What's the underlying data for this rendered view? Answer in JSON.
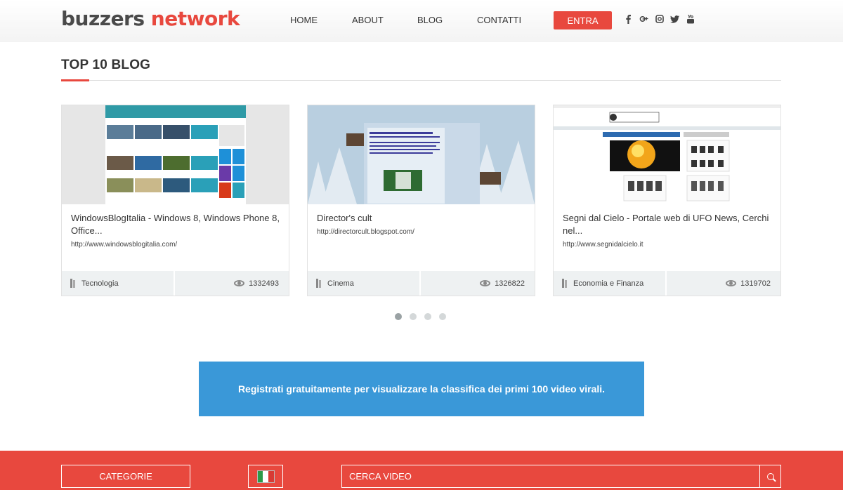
{
  "header": {
    "logo_part1": "buzzers",
    "logo_part2": "network",
    "nav": [
      "HOME",
      "ABOUT",
      "BLOG",
      "CONTATTI"
    ],
    "entra_label": "ENTRA",
    "social_icons": [
      "facebook-icon",
      "google-plus-icon",
      "instagram-icon",
      "twitter-icon",
      "youtube-icon"
    ]
  },
  "section": {
    "title": "TOP 10 BLOG"
  },
  "cards": [
    {
      "title": "WindowsBlogItalia - Windows 8, Windows Phone 8, Office...",
      "url": "http://www.windowsblogitalia.com/",
      "category": "Tecnologia",
      "views": "1332493",
      "thumb_label": "WindowsBlogItalia"
    },
    {
      "title": "Director's cult",
      "url": "http://directorcult.blogspot.com/",
      "category": "Cinema",
      "views": "1326822",
      "thumb_label": "Director's cult"
    },
    {
      "title": "Segni dal Cielo - Portale web di UFO News, Cerchi nel...",
      "url": "http://www.segnidalcielo.it",
      "category": "Economia e Finanza",
      "views": "1319702",
      "thumb_label": "segnidalcielo"
    }
  ],
  "carousel": {
    "pages": 4,
    "active": 0
  },
  "banner": {
    "text": "Registrati gratuitamente per visualizzare la classifica dei primi 100 video virali."
  },
  "footer": {
    "categories_label": "CATEGORIE",
    "search_placeholder": "CERCA VIDEO",
    "flag_colors": [
      "#2b9a48",
      "#ffffff",
      "#d83a34"
    ]
  },
  "colors": {
    "accent": "#e8483e",
    "banner": "#3a98d8",
    "card_footer": "#eef1f2"
  }
}
